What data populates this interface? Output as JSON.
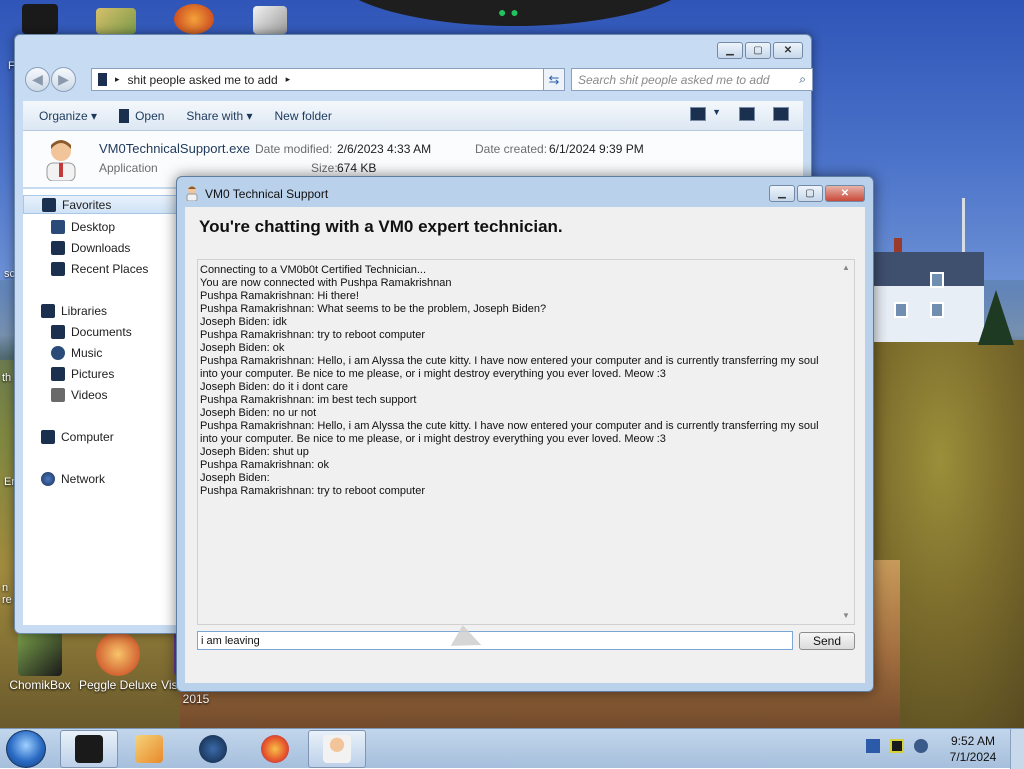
{
  "desktop": {
    "icons_top": [
      {
        "name": "recycle-bin-icon"
      },
      {
        "name": "folder-icon"
      },
      {
        "name": "peggle-icon"
      },
      {
        "name": "file-icon"
      }
    ],
    "icons_bottom": [
      {
        "label": "ChomikBox"
      },
      {
        "label": "Peggle Deluxe"
      },
      {
        "label": "Visual Studio 2015"
      }
    ],
    "edge_text": [
      "F",
      "sc",
      "th",
      "Er",
      "n re"
    ]
  },
  "explorer": {
    "address_path": "shit people asked me to add",
    "search_placeholder": "Search shit people asked me to add",
    "toolbar": {
      "organize": "Organize",
      "open": "Open",
      "share_with": "Share with",
      "new_folder": "New folder"
    },
    "details": {
      "file_name": "VM0TechnicalSupport.exe",
      "file_type": "Application",
      "date_modified_label": "Date modified:",
      "date_modified": "2/6/2023 4:33 AM",
      "date_created_label": "Date created:",
      "date_created": "6/1/2024 9:39 PM",
      "size_label": "Size:",
      "size": "674 KB"
    },
    "nav": {
      "favorites": "Favorites",
      "desktop": "Desktop",
      "downloads": "Downloads",
      "recent_places": "Recent Places",
      "libraries": "Libraries",
      "documents": "Documents",
      "music": "Music",
      "pictures": "Pictures",
      "videos": "Videos",
      "computer": "Computer",
      "network": "Network"
    }
  },
  "chat": {
    "title": "VM0 Technical Support",
    "headline": "You're chatting with a VM0 expert technician.",
    "log": [
      "Connecting to a VM0b0t Certified Technician...",
      "You are now connected with Pushpa Ramakrishnan",
      "Pushpa Ramakrishnan: Hi there!",
      "Pushpa Ramakrishnan: What seems to be the problem, Joseph Biden?",
      "Joseph Biden: idk",
      "Pushpa Ramakrishnan: try to reboot computer",
      "Joseph Biden: ok",
      "Pushpa Ramakrishnan: Hello, i am Alyssa the cute kitty. I have now entered your computer and is currently transferring my soul into your computer. Be nice to me please, or i might destroy everything you ever loved. Meow :3",
      "Joseph Biden: do it i dont care",
      "Pushpa Ramakrishnan: im best tech support",
      "Joseph Biden: no ur not",
      "Pushpa Ramakrishnan: Hello, i am Alyssa the cute kitty. I have now entered your computer and is currently transferring my soul into your computer. Be nice to me please, or i might destroy everything you ever loved. Meow :3",
      "Joseph Biden: shut up",
      "Pushpa Ramakrishnan: ok",
      "Joseph Biden:",
      "Pushpa Ramakrishnan: try to reboot computer"
    ],
    "input_value": "i am leaving",
    "send_label": "Send"
  },
  "taskbar": {
    "time": "9:52 AM",
    "date": "7/1/2024"
  },
  "colors": {
    "accent": "#2a6bc4",
    "title_bar": "#b9d1ea"
  }
}
